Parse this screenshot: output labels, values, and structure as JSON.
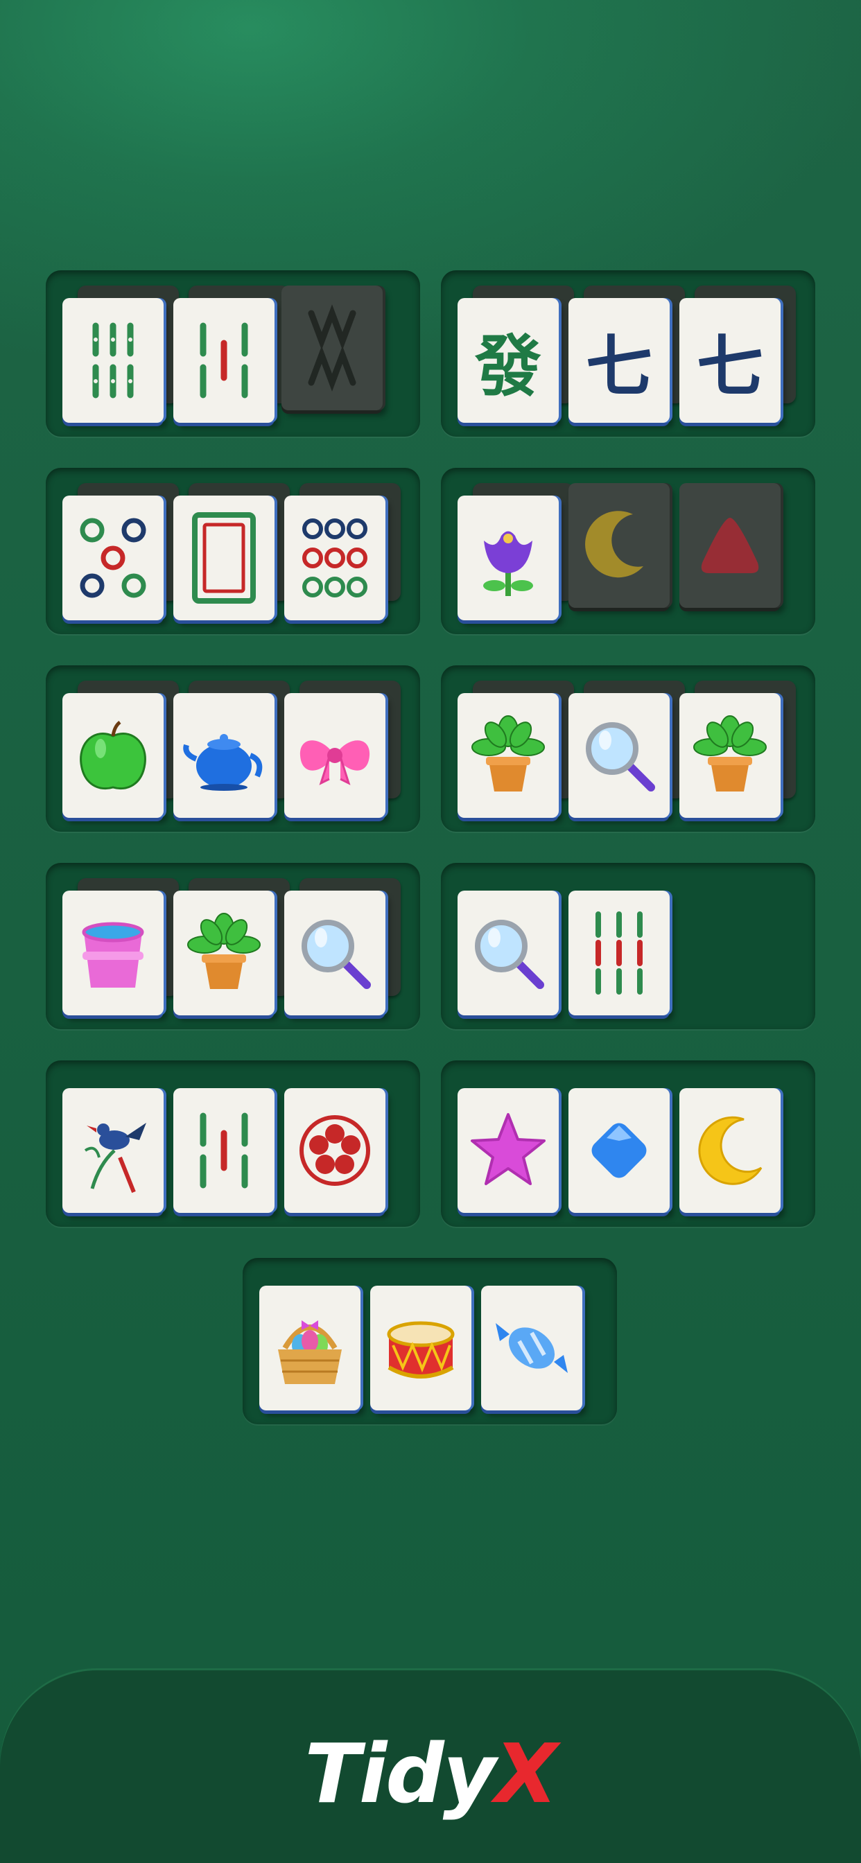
{
  "brand": {
    "name": "Tidy",
    "accent": "X",
    "accent_color": "#e8282e"
  },
  "colors": {
    "felt": "#197049",
    "tray": "#0e4d31",
    "tile_face": "#f3f2ec",
    "tile_edge": "#3f6fbf"
  },
  "trays": [
    {
      "tiles": [
        "bamboo-6",
        "bamboo-7",
        "bamboo-8"
      ],
      "covered_tiles": [
        "bamboo-8"
      ]
    },
    {
      "tiles": [
        "green-dragon",
        "character-7",
        "character-7"
      ],
      "glyphs": {
        "green-dragon": "發",
        "character-7": "七"
      }
    },
    {
      "tiles": [
        "dots-5",
        "white-dragon",
        "dots-9"
      ]
    },
    {
      "tiles": [
        "flower-tulip",
        "moon",
        "red-gem"
      ],
      "covered_tiles": [
        "moon",
        "red-gem"
      ]
    },
    {
      "tiles": [
        "apple",
        "teapot",
        "bow"
      ]
    },
    {
      "tiles": [
        "potted-plant",
        "magnifier",
        "potted-plant"
      ]
    },
    {
      "tiles": [
        "bucket",
        "potted-plant",
        "magnifier"
      ]
    },
    {
      "tiles": [
        "magnifier",
        "bamboo-9"
      ]
    },
    {
      "tiles": [
        "bird-bamboo-1",
        "bamboo-7",
        "plum-flower"
      ]
    },
    {
      "tiles": [
        "star",
        "diamond-gem",
        "moon"
      ]
    },
    {
      "tiles": [
        "easter-basket",
        "drum",
        "candy"
      ]
    }
  ]
}
